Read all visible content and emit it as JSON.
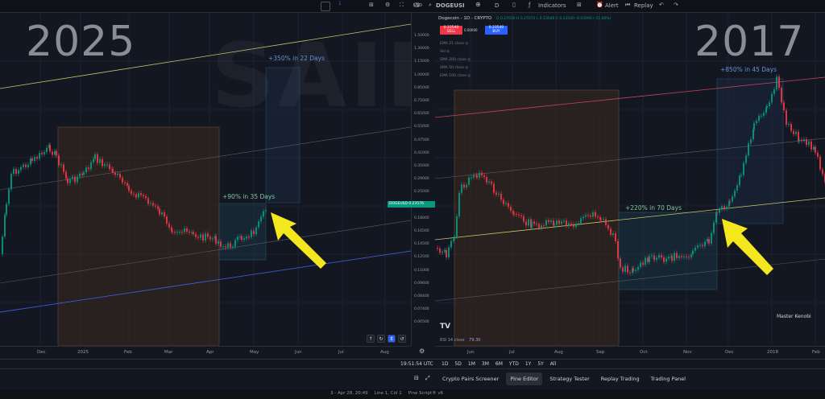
{
  "toolbar": {
    "interval": "1",
    "symbol": "DOGEUSI",
    "interval_d": "D",
    "indicators_label": "Indicators",
    "alert_label": "Alert",
    "replay_label": "Replay",
    "currency": "USD"
  },
  "legend": {
    "title": "Dogecoin - 1D - CRYPTO",
    "ohlc": "O 0.27030 H 0.27072 L 0.23540 C 0.23540 -0.03090 (-11.60%)",
    "sell_price": "0.23540",
    "sell_label": "SELL",
    "buy_price": "0.23540",
    "buy_label": "BUY",
    "spread": "0.00000",
    "indicators": [
      "EMA 21 close",
      "Vol",
      "SMA 200 close",
      "SMA 50 close",
      "EMA 100 close"
    ]
  },
  "left_chart": {
    "year": "2025",
    "annot_top": "+350% in 22 Days",
    "annot_mid": "+90% in 35 Days",
    "time_labels": [
      "Dec",
      "2025",
      "Feb",
      "Mar",
      "Apr",
      "May",
      "Jun",
      "Jul",
      "Aug"
    ]
  },
  "right_chart": {
    "year": "2017",
    "annot_top": "+850% in 45 Days",
    "annot_mid": "+220% in 70 Days",
    "author": "Master Kenobi",
    "rsi_label": "RSI 14 close",
    "rsi_value": "79.30",
    "time_labels": [
      "Jun",
      "Jul",
      "Aug",
      "Sep",
      "Oct",
      "Nov",
      "Dec",
      "2018",
      "Feb"
    ]
  },
  "watermark": "SAIKI",
  "price_axis": {
    "ticks": [
      "1.50000",
      "1.30000",
      "1.15000",
      "1.00000",
      "0.85000",
      "0.75000",
      "0.65000",
      "0.55000",
      "0.47500",
      "0.41000",
      "0.35000",
      "0.29000",
      "0.25000",
      "0.21000",
      "0.18000",
      "0.16500",
      "0.14500",
      "0.12500",
      "0.11000",
      "0.09600",
      "0.08400",
      "0.07400",
      "0.06500"
    ],
    "symbol_tag": "DOGEUSD",
    "price_tag": "0.23576"
  },
  "bottom": {
    "clock": "19:51:54 UTC",
    "ranges": [
      "1D",
      "5D",
      "1M",
      "3M",
      "6M",
      "YTD",
      "1Y",
      "5Y",
      "All"
    ],
    "tabs": [
      "Crypto Pairs Screener",
      "Pine Editor",
      "Strategy Tester",
      "Replay Trading",
      "Trading Panel"
    ],
    "status": [
      "3 - Apr 28, 20:49",
      "Line 1, Col 1",
      "Pine Script® v6"
    ]
  },
  "colors": {
    "up": "#089981",
    "down": "#f23645",
    "accent": "#2962ff",
    "arrow": "#f5e71d"
  }
}
